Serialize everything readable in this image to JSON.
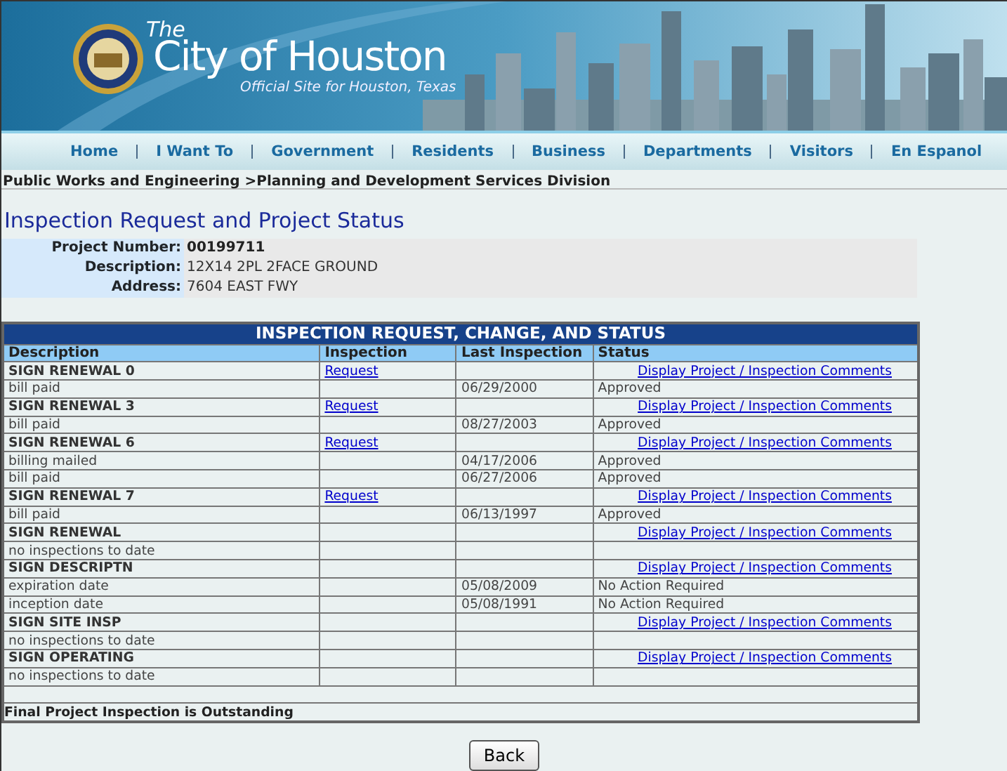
{
  "header": {
    "the": "The",
    "title": "City of Houston",
    "subtitle": "Official Site for Houston, Texas"
  },
  "nav": [
    {
      "label": "Home"
    },
    {
      "label": "I Want To"
    },
    {
      "label": "Government"
    },
    {
      "label": "Residents"
    },
    {
      "label": "Business"
    },
    {
      "label": "Departments"
    },
    {
      "label": "Visitors"
    },
    {
      "label": "En Espanol"
    }
  ],
  "breadcrumb": "Public Works and Engineering >Planning and Development Services Division",
  "page_title": "Inspection Request and Project Status",
  "project": [
    {
      "label": "Project Number:",
      "value": "00199711",
      "bold": true
    },
    {
      "label": "Description:",
      "value": "12X14 2PL 2FACE GROUND",
      "bold": false
    },
    {
      "label": "Address:",
      "value": "7604 EAST FWY",
      "bold": false
    }
  ],
  "table": {
    "title": "INSPECTION REQUEST, CHANGE, AND STATUS",
    "columns": [
      "Description",
      "Inspection",
      "Last Inspection",
      "Status"
    ],
    "rows": [
      {
        "kind": "group",
        "description": "SIGN RENEWAL 0",
        "inspection": "Request",
        "status": "Display Project / Inspection Comments"
      },
      {
        "kind": "detail",
        "description": "bill paid",
        "last_inspection": "06/29/2000",
        "status": "Approved"
      },
      {
        "kind": "group",
        "description": "SIGN RENEWAL 3",
        "inspection": "Request",
        "status": "Display Project / Inspection Comments"
      },
      {
        "kind": "detail",
        "description": "bill paid",
        "last_inspection": "08/27/2003",
        "status": "Approved"
      },
      {
        "kind": "group",
        "description": "SIGN RENEWAL 6",
        "inspection": "Request",
        "status": "Display Project / Inspection Comments"
      },
      {
        "kind": "detail",
        "description": "billing mailed",
        "last_inspection": "04/17/2006",
        "status": "Approved"
      },
      {
        "kind": "detail",
        "description": "bill paid",
        "last_inspection": "06/27/2006",
        "status": "Approved"
      },
      {
        "kind": "group",
        "description": "SIGN RENEWAL 7",
        "inspection": "Request",
        "status": "Display Project / Inspection Comments"
      },
      {
        "kind": "detail",
        "description": "bill paid",
        "last_inspection": "06/13/1997",
        "status": "Approved"
      },
      {
        "kind": "group",
        "description": "SIGN RENEWAL",
        "status": "Display Project / Inspection Comments"
      },
      {
        "kind": "detail",
        "description": "no inspections to date"
      },
      {
        "kind": "group",
        "description": "SIGN DESCRIPTN",
        "status": "Display Project / Inspection Comments"
      },
      {
        "kind": "detail",
        "description": "expiration date",
        "last_inspection": "05/08/2009",
        "status": "No Action Required"
      },
      {
        "kind": "detail",
        "description": "inception date",
        "last_inspection": "05/08/1991",
        "status": "No Action Required"
      },
      {
        "kind": "group",
        "description": "SIGN SITE INSP",
        "status": "Display Project / Inspection Comments"
      },
      {
        "kind": "detail",
        "description": "no inspections to date"
      },
      {
        "kind": "group",
        "description": "SIGN OPERATING",
        "status": "Display Project / Inspection Comments"
      },
      {
        "kind": "detail",
        "description": "no inspections to date"
      }
    ],
    "footer": "Final Project Inspection is Outstanding"
  },
  "back_button": "Back"
}
